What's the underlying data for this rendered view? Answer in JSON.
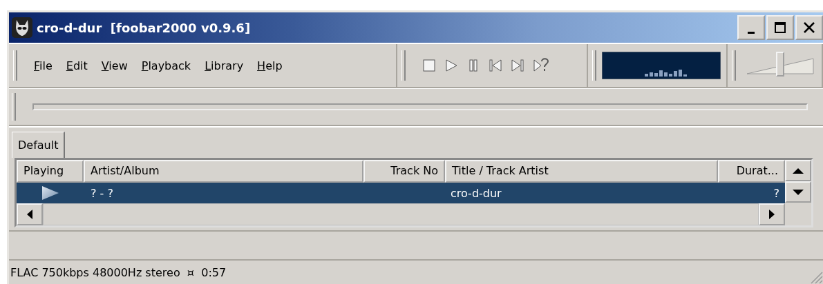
{
  "window": {
    "title": "cro-d-dur  [foobar2000 v0.9.6]"
  },
  "menu": [
    "File",
    "Edit",
    "View",
    "Playback",
    "Library",
    "Help"
  ],
  "volume": {
    "level": 0.5
  },
  "tabs": [
    {
      "label": "Default",
      "selected": true
    }
  ],
  "table": {
    "columns": [
      "Playing",
      "Artist/Album",
      "Track No",
      "Title / Track Artist",
      "Durat..."
    ],
    "rows": [
      {
        "playing": true,
        "selected": true,
        "cells": [
          "",
          "? - ?",
          "",
          "cro-d-dur",
          "?"
        ]
      }
    ]
  },
  "status_bar": "FLAC 750kbps 48000Hz stereo  ¤  0:57"
}
